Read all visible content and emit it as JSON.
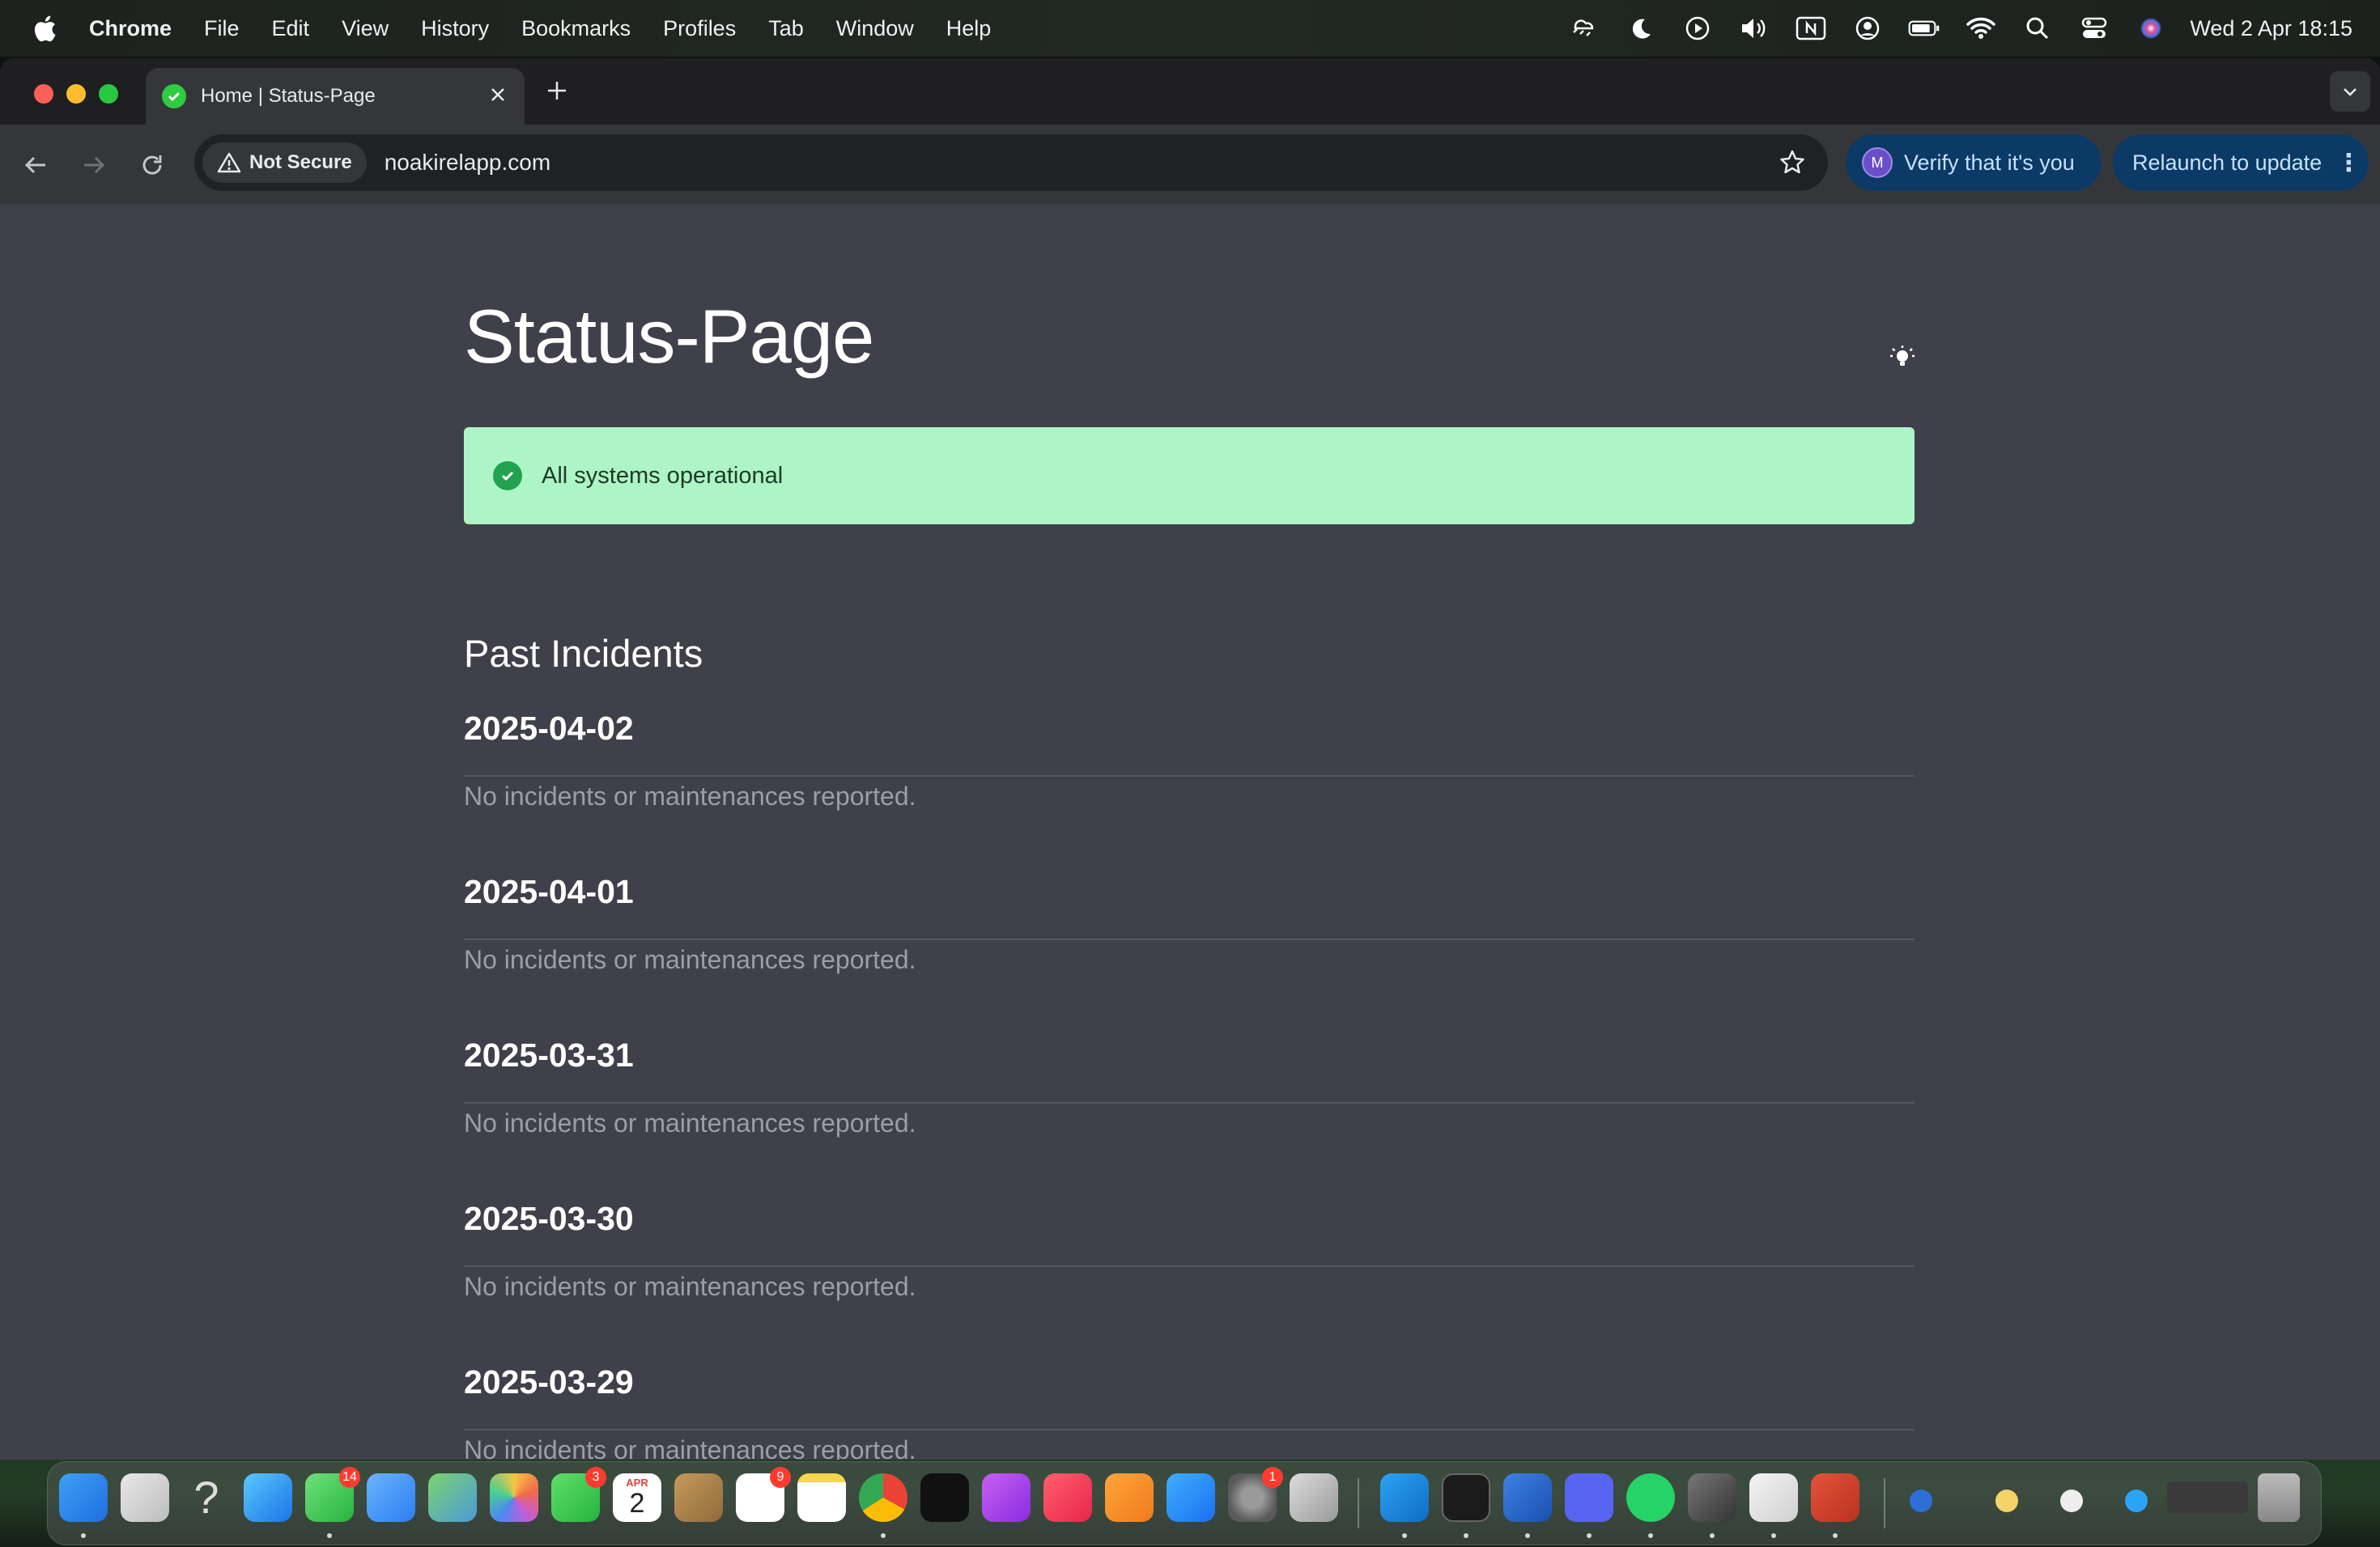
{
  "menubar": {
    "app_name": "Chrome",
    "items": [
      "File",
      "Edit",
      "View",
      "History",
      "Bookmarks",
      "Profiles",
      "Tab",
      "Window",
      "Help"
    ],
    "clock": "Wed 2 Apr  18:15"
  },
  "browser": {
    "tab_title": "Home | Status-Page",
    "security_label": "Not Secure",
    "url": "noakirelapp.com",
    "verify_label": "Verify that it's you",
    "profile_initial": "M",
    "relaunch_label": "Relaunch to update"
  },
  "page": {
    "title": "Status-Page",
    "status_banner": "All systems operational",
    "section_title": "Past Incidents",
    "incidents": [
      {
        "date": "2025-04-02",
        "note": "No incidents or maintenances reported."
      },
      {
        "date": "2025-04-01",
        "note": "No incidents or maintenances reported."
      },
      {
        "date": "2025-03-31",
        "note": "No incidents or maintenances reported."
      },
      {
        "date": "2025-03-30",
        "note": "No incidents or maintenances reported."
      },
      {
        "date": "2025-03-29",
        "note": "No incidents or maintenances reported."
      }
    ]
  },
  "dock": {
    "calendar_month": "APR",
    "calendar_day": "2",
    "badges": {
      "messages": "14",
      "facetime": "3",
      "reminders": "9",
      "settings": "1"
    }
  },
  "colors": {
    "page_bg": "#3f4049",
    "banner_bg": "#adf5c6",
    "banner_icon": "#22a24f",
    "accent_pill": "#0b3a66"
  }
}
